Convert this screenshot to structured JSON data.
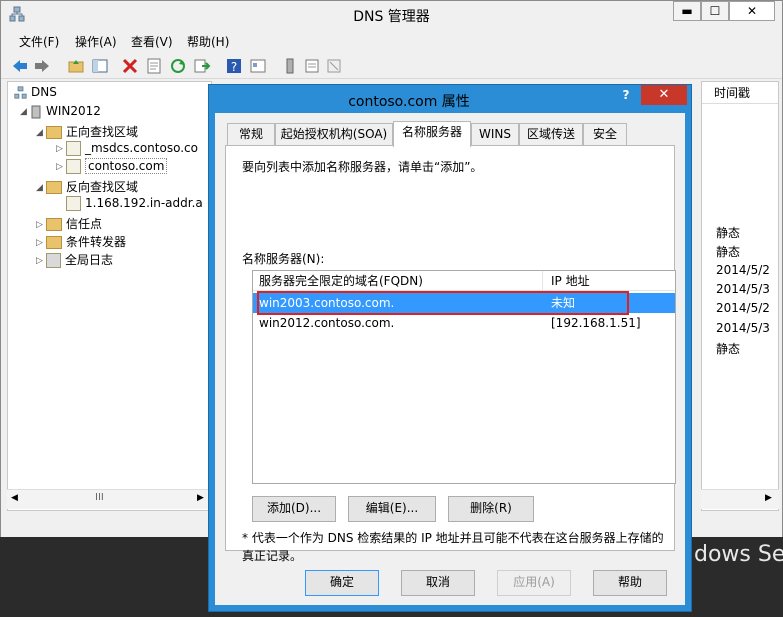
{
  "window": {
    "title": "DNS 管理器",
    "minimize": "▬",
    "maximize": "☐",
    "close": "✕"
  },
  "menu": [
    "文件(F)",
    "操作(A)",
    "查看(V)",
    "帮助(H)"
  ],
  "tree": {
    "root": "DNS",
    "server": "WIN2012",
    "forward_zones": "正向查找区域",
    "msdcs": "_msdcs.contoso.co",
    "contoso": "contoso.com",
    "reverse_zones": "反向查找区域",
    "reverse_zone": "1.168.192.in-addr.a",
    "trust_points": "信任点",
    "conditional_forwarders": "条件转发器",
    "global_logs": "全局日志",
    "scroll_thumb": "III"
  },
  "right_pane": {
    "header": "时间戳",
    "rows": [
      "静态",
      "静态",
      "2014/5/2",
      "2014/5/3",
      "2014/5/2",
      "2014/5/3",
      "静态"
    ]
  },
  "desktop_text": "dows Se",
  "dialog": {
    "title": "contoso.com 属性",
    "help_btn": "?",
    "close_btn": "✕",
    "tabs": [
      "常规",
      "起始授权机构(SOA)",
      "名称服务器",
      "WINS",
      "区域传送",
      "安全"
    ],
    "active_tab": "名称服务器",
    "instruction": "要向列表中添加名称服务器，请单击“添加”。",
    "ns_label": "名称服务器(N):",
    "columns": [
      "服务器完全限定的域名(FQDN)",
      "IP 地址"
    ],
    "rows": [
      {
        "fqdn": "win2003.contoso.com.",
        "ip": "未知"
      },
      {
        "fqdn": "win2012.contoso.com.",
        "ip": "[192.168.1.51]"
      }
    ],
    "btn_add": "添加(D)...",
    "btn_edit": "编辑(E)...",
    "btn_remove": "删除(R)",
    "note": "* 代表一个作为 DNS 检索结果的 IP 地址并且可能不代表在这台服务器上存储的真正记录。",
    "btn_ok": "确定",
    "btn_cancel": "取消",
    "btn_apply": "应用(A)",
    "btn_help": "帮助"
  }
}
